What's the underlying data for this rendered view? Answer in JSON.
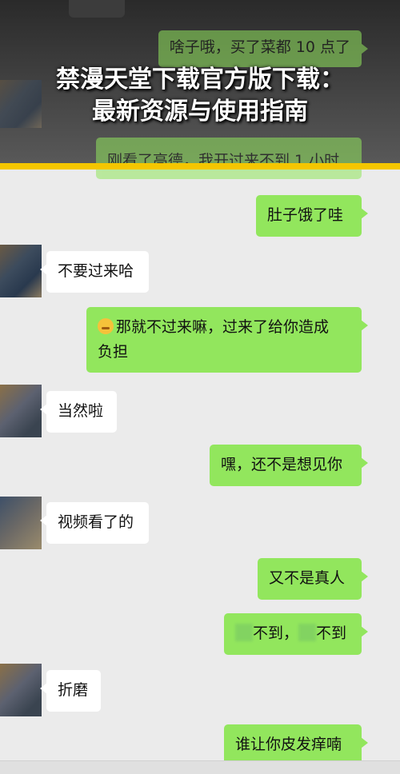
{
  "overlay": {
    "title_line1": "禁漫天堂下载官方版下载：",
    "title_line2": "最新资源与使用指南"
  },
  "messages": [
    {
      "side": "out",
      "text": "啥子哦，买了菜都 10 点了"
    },
    {
      "side": "out",
      "text": "刚看了高德，我开过来不到 1 小时"
    },
    {
      "side": "out",
      "text": "肚子饿了哇"
    },
    {
      "side": "in",
      "text": "不要过来哈"
    },
    {
      "side": "out",
      "text_line1": "那就不过来嘛，过来了给你造成",
      "text_line2": "负担"
    },
    {
      "side": "in",
      "text": "当然啦"
    },
    {
      "side": "out",
      "text": "嘿，还不是想见你"
    },
    {
      "side": "in",
      "text": "视频看了的"
    },
    {
      "side": "out",
      "text": "又不是真人"
    },
    {
      "side": "out",
      "part1": "不到，",
      "part2": "不到"
    },
    {
      "side": "in",
      "text": "折磨"
    },
    {
      "side": "out",
      "text": "谁让你皮发痒喃"
    }
  ],
  "colors": {
    "sent_bubble": "#92e65d",
    "received_bubble": "#ffffff",
    "background": "#ebebeb",
    "accent": "#f4c600"
  }
}
